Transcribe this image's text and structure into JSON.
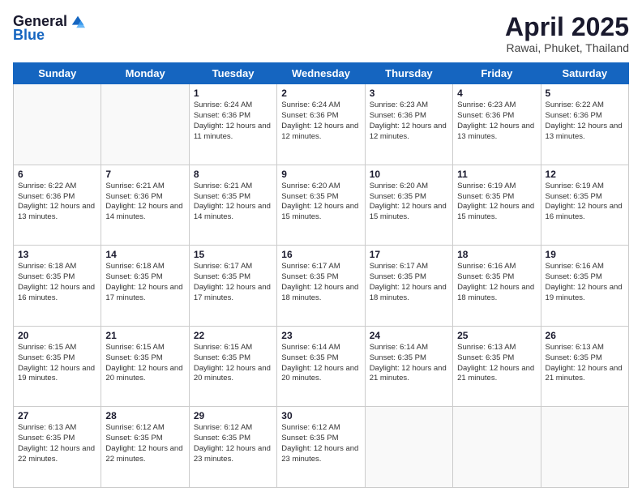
{
  "logo": {
    "general": "General",
    "blue": "Blue"
  },
  "header": {
    "month": "April 2025",
    "location": "Rawai, Phuket, Thailand"
  },
  "days_of_week": [
    "Sunday",
    "Monday",
    "Tuesday",
    "Wednesday",
    "Thursday",
    "Friday",
    "Saturday"
  ],
  "weeks": [
    [
      {
        "day": "",
        "info": ""
      },
      {
        "day": "",
        "info": ""
      },
      {
        "day": "1",
        "info": "Sunrise: 6:24 AM\nSunset: 6:36 PM\nDaylight: 12 hours and 11 minutes."
      },
      {
        "day": "2",
        "info": "Sunrise: 6:24 AM\nSunset: 6:36 PM\nDaylight: 12 hours and 12 minutes."
      },
      {
        "day": "3",
        "info": "Sunrise: 6:23 AM\nSunset: 6:36 PM\nDaylight: 12 hours and 12 minutes."
      },
      {
        "day": "4",
        "info": "Sunrise: 6:23 AM\nSunset: 6:36 PM\nDaylight: 12 hours and 13 minutes."
      },
      {
        "day": "5",
        "info": "Sunrise: 6:22 AM\nSunset: 6:36 PM\nDaylight: 12 hours and 13 minutes."
      }
    ],
    [
      {
        "day": "6",
        "info": "Sunrise: 6:22 AM\nSunset: 6:36 PM\nDaylight: 12 hours and 13 minutes."
      },
      {
        "day": "7",
        "info": "Sunrise: 6:21 AM\nSunset: 6:36 PM\nDaylight: 12 hours and 14 minutes."
      },
      {
        "day": "8",
        "info": "Sunrise: 6:21 AM\nSunset: 6:35 PM\nDaylight: 12 hours and 14 minutes."
      },
      {
        "day": "9",
        "info": "Sunrise: 6:20 AM\nSunset: 6:35 PM\nDaylight: 12 hours and 15 minutes."
      },
      {
        "day": "10",
        "info": "Sunrise: 6:20 AM\nSunset: 6:35 PM\nDaylight: 12 hours and 15 minutes."
      },
      {
        "day": "11",
        "info": "Sunrise: 6:19 AM\nSunset: 6:35 PM\nDaylight: 12 hours and 15 minutes."
      },
      {
        "day": "12",
        "info": "Sunrise: 6:19 AM\nSunset: 6:35 PM\nDaylight: 12 hours and 16 minutes."
      }
    ],
    [
      {
        "day": "13",
        "info": "Sunrise: 6:18 AM\nSunset: 6:35 PM\nDaylight: 12 hours and 16 minutes."
      },
      {
        "day": "14",
        "info": "Sunrise: 6:18 AM\nSunset: 6:35 PM\nDaylight: 12 hours and 17 minutes."
      },
      {
        "day": "15",
        "info": "Sunrise: 6:17 AM\nSunset: 6:35 PM\nDaylight: 12 hours and 17 minutes."
      },
      {
        "day": "16",
        "info": "Sunrise: 6:17 AM\nSunset: 6:35 PM\nDaylight: 12 hours and 18 minutes."
      },
      {
        "day": "17",
        "info": "Sunrise: 6:17 AM\nSunset: 6:35 PM\nDaylight: 12 hours and 18 minutes."
      },
      {
        "day": "18",
        "info": "Sunrise: 6:16 AM\nSunset: 6:35 PM\nDaylight: 12 hours and 18 minutes."
      },
      {
        "day": "19",
        "info": "Sunrise: 6:16 AM\nSunset: 6:35 PM\nDaylight: 12 hours and 19 minutes."
      }
    ],
    [
      {
        "day": "20",
        "info": "Sunrise: 6:15 AM\nSunset: 6:35 PM\nDaylight: 12 hours and 19 minutes."
      },
      {
        "day": "21",
        "info": "Sunrise: 6:15 AM\nSunset: 6:35 PM\nDaylight: 12 hours and 20 minutes."
      },
      {
        "day": "22",
        "info": "Sunrise: 6:15 AM\nSunset: 6:35 PM\nDaylight: 12 hours and 20 minutes."
      },
      {
        "day": "23",
        "info": "Sunrise: 6:14 AM\nSunset: 6:35 PM\nDaylight: 12 hours and 20 minutes."
      },
      {
        "day": "24",
        "info": "Sunrise: 6:14 AM\nSunset: 6:35 PM\nDaylight: 12 hours and 21 minutes."
      },
      {
        "day": "25",
        "info": "Sunrise: 6:13 AM\nSunset: 6:35 PM\nDaylight: 12 hours and 21 minutes."
      },
      {
        "day": "26",
        "info": "Sunrise: 6:13 AM\nSunset: 6:35 PM\nDaylight: 12 hours and 21 minutes."
      }
    ],
    [
      {
        "day": "27",
        "info": "Sunrise: 6:13 AM\nSunset: 6:35 PM\nDaylight: 12 hours and 22 minutes."
      },
      {
        "day": "28",
        "info": "Sunrise: 6:12 AM\nSunset: 6:35 PM\nDaylight: 12 hours and 22 minutes."
      },
      {
        "day": "29",
        "info": "Sunrise: 6:12 AM\nSunset: 6:35 PM\nDaylight: 12 hours and 23 minutes."
      },
      {
        "day": "30",
        "info": "Sunrise: 6:12 AM\nSunset: 6:35 PM\nDaylight: 12 hours and 23 minutes."
      },
      {
        "day": "",
        "info": ""
      },
      {
        "day": "",
        "info": ""
      },
      {
        "day": "",
        "info": ""
      }
    ]
  ]
}
